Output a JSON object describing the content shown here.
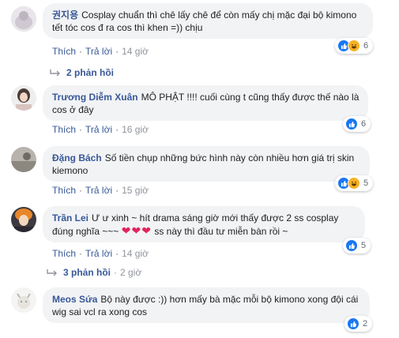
{
  "comments": [
    {
      "author": "권지용",
      "text": "Cosplay chuẩn thì chê lấy chê để còn mấy chị mặc đại bộ kimono tết tóc cos đ ra cos thì khen =)) chịu",
      "like_label": "Thích",
      "reply_label": "Trả lời",
      "time": "14 giờ",
      "reactions": [
        "like",
        "haha"
      ],
      "reaction_count": "6",
      "replies_label": "2 phản hồi",
      "replies_time": ""
    },
    {
      "author": "Trương Diễm Xuân",
      "text": "MÔ PHẬT !!!! cuối cùng t cũng thấy được thế nào là cos ở đây",
      "like_label": "Thích",
      "reply_label": "Trả lời",
      "time": "16 giờ",
      "reactions": [
        "like"
      ],
      "reaction_count": "6"
    },
    {
      "author": "Đặng Bách",
      "text": "Số tiền chụp những bức hình này còn nhiều hơn giá trị skin kiemono",
      "like_label": "Thích",
      "reply_label": "Trả lời",
      "time": "15 giờ",
      "reactions": [
        "like",
        "haha"
      ],
      "reaction_count": "5"
    },
    {
      "author": "Trần Lei",
      "text_before": "Ư ư xinh ~ hít drama sáng giờ mới thấy được 2 ss cosplay đúng nghĩa ~~~",
      "hearts": "❤❤❤",
      "text_after": "ss này thì đầu tư miễn bàn rồi ~",
      "like_label": "Thích",
      "reply_label": "Trả lời",
      "time": "14 giờ",
      "reactions": [
        "like"
      ],
      "reaction_count": "5",
      "replies_label": "3 phản hồi",
      "replies_time": "2 giờ"
    },
    {
      "author": "Meos Sứa",
      "text": "Bộ này được :)) hơn mấy bà mặc mỗi bộ kimono xong đội cái wig sai vcl ra xong cos",
      "like_label": "Thích",
      "reply_label": "Trả lời",
      "time": "15 giờ",
      "reactions": [
        "like"
      ],
      "reaction_count": "2"
    }
  ],
  "colors": {
    "author": "#385898",
    "bubble": "#f2f3f5",
    "like": "#1877f2",
    "haha": "#f7b125",
    "heart": "#e0245e",
    "time": "#90949c"
  }
}
